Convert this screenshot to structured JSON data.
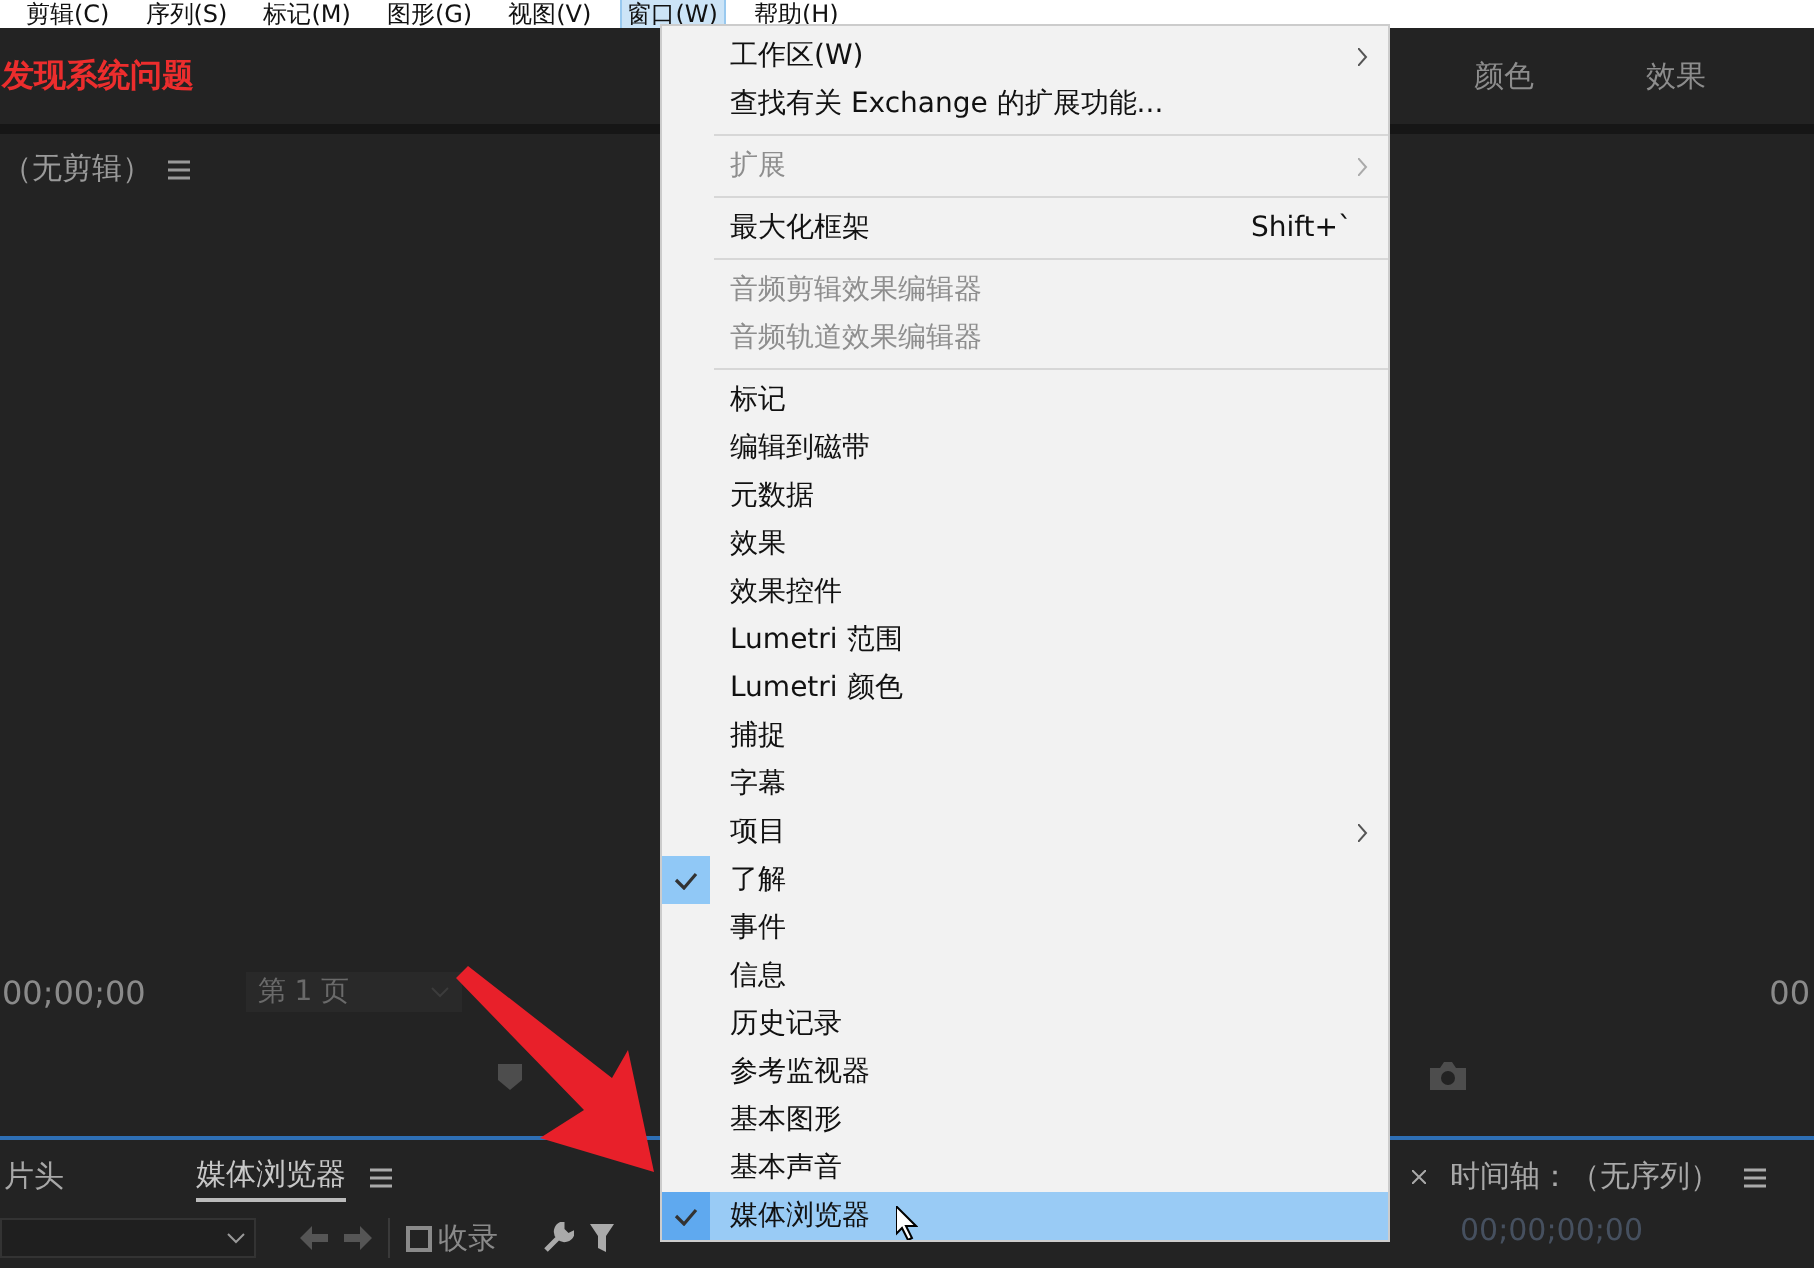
{
  "menubar": [
    {
      "label": "剪辑(C)",
      "selected": false
    },
    {
      "label": "序列(S)",
      "selected": false
    },
    {
      "label": "标记(M)",
      "selected": false
    },
    {
      "label": "图形(G)",
      "selected": false
    },
    {
      "label": "视图(V)",
      "selected": false
    },
    {
      "label": "窗口(W)",
      "selected": true
    },
    {
      "label": "帮助(H)",
      "selected": false
    }
  ],
  "header": {
    "alert": "发现系统问题",
    "tabs": [
      {
        "label": "颜色"
      },
      {
        "label": "效果"
      }
    ]
  },
  "source_monitor": {
    "title": "（无剪辑）",
    "timecode": "00;00;00",
    "page_select": "第 1 页"
  },
  "program_monitor": {
    "timecode": "00"
  },
  "lower_left": {
    "tabs": [
      {
        "label": "片头",
        "selected": false
      },
      {
        "label": "媒体浏览器",
        "selected": true
      }
    ],
    "ingest": {
      "label": "收录",
      "checked": false
    }
  },
  "timeline": {
    "title": "时间轴：（无序列）",
    "timecode": "00;00;00;00"
  },
  "window_menu": {
    "items": [
      {
        "kind": "item",
        "label": "工作区(W)",
        "submenu": true,
        "disabled": false,
        "checked": false,
        "selected": false
      },
      {
        "kind": "item",
        "label": "查找有关 Exchange 的扩展功能...",
        "submenu": false,
        "disabled": false,
        "checked": false,
        "selected": false
      },
      {
        "kind": "separator"
      },
      {
        "kind": "item",
        "label": "扩展",
        "submenu": true,
        "disabled": true,
        "checked": false,
        "selected": false
      },
      {
        "kind": "separator"
      },
      {
        "kind": "item",
        "label": "最大化框架",
        "shortcut": "Shift+`",
        "submenu": false,
        "disabled": false,
        "checked": false,
        "selected": false
      },
      {
        "kind": "separator"
      },
      {
        "kind": "item",
        "label": "音频剪辑效果编辑器",
        "submenu": false,
        "disabled": true,
        "checked": false,
        "selected": false
      },
      {
        "kind": "item",
        "label": "音频轨道效果编辑器",
        "submenu": false,
        "disabled": true,
        "checked": false,
        "selected": false
      },
      {
        "kind": "separator"
      },
      {
        "kind": "item",
        "label": "标记",
        "submenu": false,
        "disabled": false,
        "checked": false,
        "selected": false
      },
      {
        "kind": "item",
        "label": "编辑到磁带",
        "submenu": false,
        "disabled": false,
        "checked": false,
        "selected": false
      },
      {
        "kind": "item",
        "label": "元数据",
        "submenu": false,
        "disabled": false,
        "checked": false,
        "selected": false
      },
      {
        "kind": "item",
        "label": "效果",
        "submenu": false,
        "disabled": false,
        "checked": false,
        "selected": false
      },
      {
        "kind": "item",
        "label": "效果控件",
        "submenu": false,
        "disabled": false,
        "checked": false,
        "selected": false
      },
      {
        "kind": "item",
        "label": "Lumetri 范围",
        "submenu": false,
        "disabled": false,
        "checked": false,
        "selected": false
      },
      {
        "kind": "item",
        "label": "Lumetri 颜色",
        "submenu": false,
        "disabled": false,
        "checked": false,
        "selected": false
      },
      {
        "kind": "item",
        "label": "捕捉",
        "submenu": false,
        "disabled": false,
        "checked": false,
        "selected": false
      },
      {
        "kind": "item",
        "label": "字幕",
        "submenu": false,
        "disabled": false,
        "checked": false,
        "selected": false
      },
      {
        "kind": "item",
        "label": "项目",
        "submenu": true,
        "disabled": false,
        "checked": false,
        "selected": false
      },
      {
        "kind": "item",
        "label": "了解",
        "submenu": false,
        "disabled": false,
        "checked": true,
        "selected": false
      },
      {
        "kind": "item",
        "label": "事件",
        "submenu": false,
        "disabled": false,
        "checked": false,
        "selected": false
      },
      {
        "kind": "item",
        "label": "信息",
        "submenu": false,
        "disabled": false,
        "checked": false,
        "selected": false
      },
      {
        "kind": "item",
        "label": "历史记录",
        "submenu": false,
        "disabled": false,
        "checked": false,
        "selected": false
      },
      {
        "kind": "item",
        "label": "参考监视器",
        "submenu": false,
        "disabled": false,
        "checked": false,
        "selected": false
      },
      {
        "kind": "item",
        "label": "基本图形",
        "submenu": false,
        "disabled": false,
        "checked": false,
        "selected": false
      },
      {
        "kind": "item",
        "label": "基本声音",
        "submenu": false,
        "disabled": false,
        "checked": false,
        "selected": false
      },
      {
        "kind": "item",
        "label": "媒体浏览器",
        "submenu": false,
        "disabled": false,
        "checked": true,
        "selected": true
      }
    ]
  }
}
